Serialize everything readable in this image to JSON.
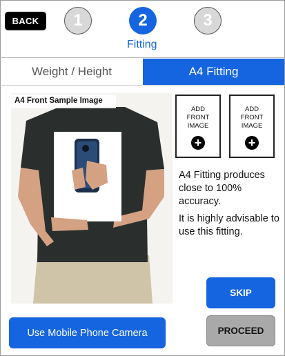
{
  "header": {
    "back_label": "BACK",
    "steps": [
      {
        "number": "1",
        "state": "inactive"
      },
      {
        "number": "2",
        "state": "active"
      },
      {
        "number": "3",
        "state": "inactive"
      }
    ],
    "active_step_label": "Fitting"
  },
  "tabs": [
    {
      "label": "Weight / Height",
      "selected": false
    },
    {
      "label": "A4 Fitting",
      "selected": true
    }
  ],
  "sample": {
    "caption": "A4 Front Sample Image"
  },
  "add_images": [
    {
      "label": "ADD\nFRONT\nIMAGE",
      "icon": "plus-circle-icon"
    },
    {
      "label": "ADD\nFRONT\nIMAGE",
      "icon": "plus-circle-icon"
    }
  ],
  "info": {
    "accuracy_text": "A4 Fitting produces close to 100% accuracy.",
    "advice_text": "It is highly advisable to use this fitting."
  },
  "buttons": {
    "skip_label": "SKIP",
    "proceed_label": "PROCEED",
    "camera_label": "Use Mobile Phone Camera"
  },
  "colors": {
    "accent": "#1565e0",
    "inactive_step": "#d8d8d8",
    "proceed_bg": "#a9a9a9"
  }
}
